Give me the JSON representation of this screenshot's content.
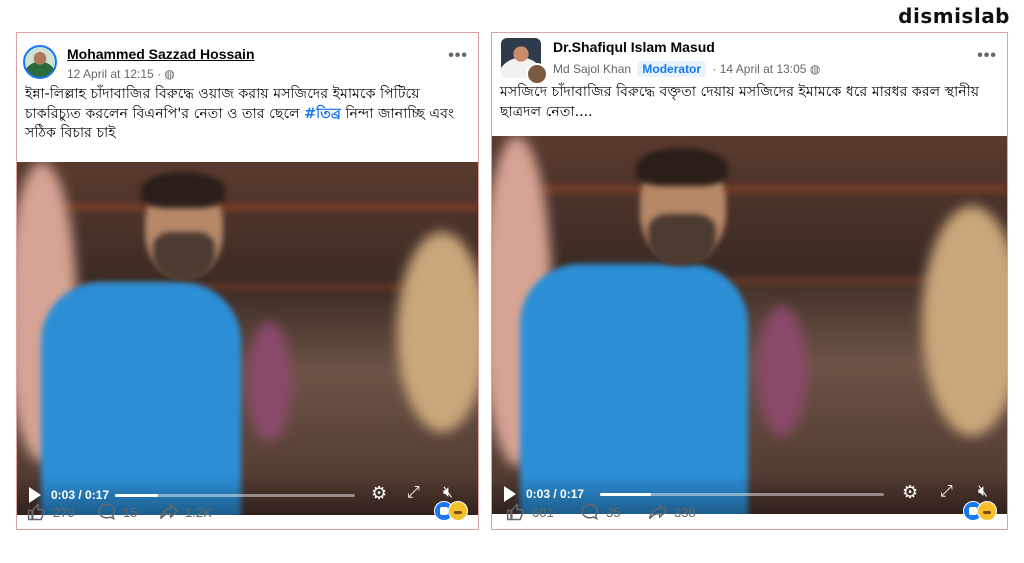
{
  "brand": "dismislab",
  "posts": [
    {
      "author": "Mohammed Sazzad Hossain",
      "date": "12 April at 12:15",
      "privacy_icon": "globe-icon",
      "menu_icon": "more-dots-icon",
      "text_a": "ইন্না-লিল্লাহ চাঁদাবাজির বিরুদ্ধে ওয়াজ করায় মসজিদের ইমামকে পিটিয়ে চাকরিচ্যুত করলেন বিএনপি'র নেতা ও তার ছেলে ",
      "hashtag": "#তিব্র",
      "text_b": " নিন্দা জানাচ্ছি এবং সঠিক বিচার চাই",
      "video": {
        "time": "0:03 / 0:17",
        "progress": 0.18
      },
      "likes": "279",
      "comments": "15",
      "shares": "1.2K"
    },
    {
      "author": "Dr.Shafiqul Islam Masud",
      "poster": "Md Sajol Khan",
      "badge": "Moderator",
      "date": "14 April at 13:05",
      "privacy_icon": "globe-icon",
      "menu_icon": "more-dots-icon",
      "text": "মসজিদে চাঁদাবাজির বিরুদ্ধে বক্তৃতা দেয়ায় মসজিদের ইমামকে ধরে মারধর করল স্থানীয় ছাত্রদল নেতা....",
      "video": {
        "time": "0:03 / 0:17",
        "progress": 0.18
      },
      "likes": "601",
      "comments": "35",
      "shares": "338"
    }
  ],
  "colors": {
    "accent": "#1877f2",
    "border": "#d9a5a5",
    "shirt": "#2c8fd6"
  }
}
